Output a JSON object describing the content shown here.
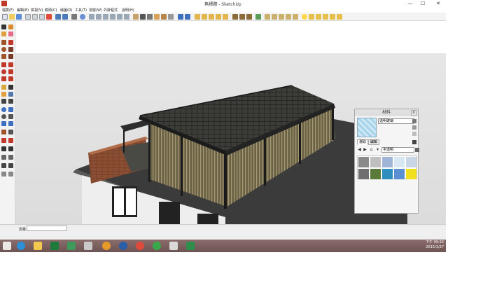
{
  "window": {
    "title": "無標題 - SketchUp",
    "controls": {
      "minimize": "—",
      "maximize": "☐",
      "close": "✕"
    }
  },
  "menu": [
    "檔案(F)",
    "編輯(E)",
    "檢視(V)",
    "鏡頭(C)",
    "繪圖(R)",
    "工具(T)",
    "視窗(W)",
    "外掛程式",
    "說明(H)"
  ],
  "status": {
    "measure_label": "測量",
    "measure_value": ""
  },
  "taskbar": {
    "time": "下午 09:32",
    "date": "2015/1/27"
  },
  "materials_panel": {
    "title": "材料",
    "close_label": "x",
    "material_name": "透明玻璃",
    "tabs": [
      "選取",
      "編輯"
    ],
    "active_tab": "選取",
    "category": "半透明",
    "swatch_colors": [
      "#8a8a8a",
      "#bfbfbf",
      "#9fb4d6",
      "#d7e8f2",
      "#c8d6e6",
      "#6f6f6f",
      "#5a7a3a",
      "#2e8fbf",
      "#5a8fd1",
      "#f0e020"
    ]
  },
  "colors": {
    "accent": "#ffd84a",
    "taskbar": "#7a5f5f",
    "sketchup_red": "#c0392b"
  }
}
